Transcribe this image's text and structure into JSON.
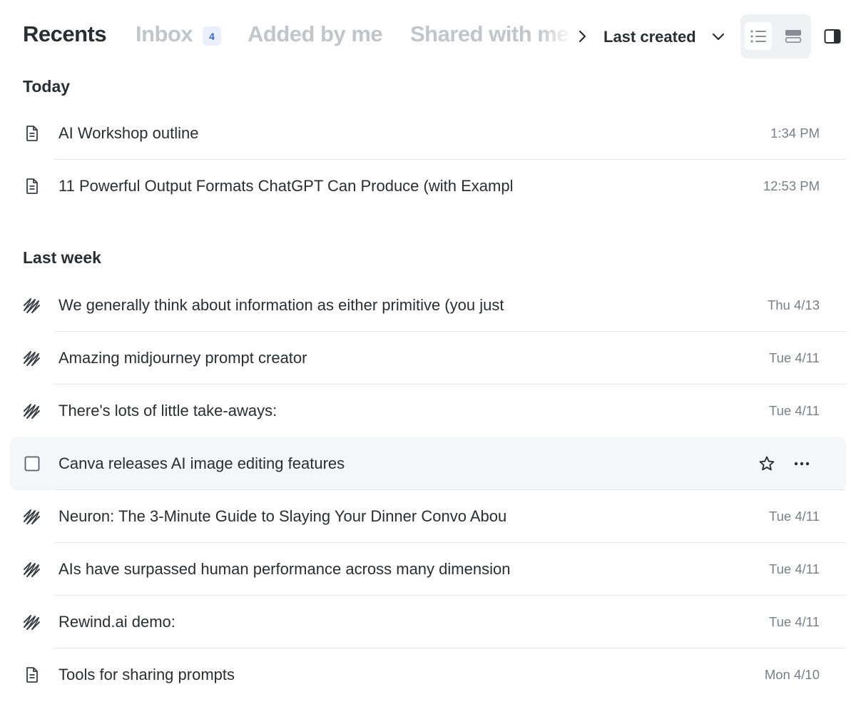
{
  "tabs": {
    "recents": "Recents",
    "inbox": "Inbox",
    "inbox_count": "4",
    "added_by_me": "Added by me",
    "shared_with_me": "Shared with me"
  },
  "sort": {
    "label": "Last created"
  },
  "sections": {
    "today": {
      "title": "Today",
      "items": [
        {
          "icon": "document-icon",
          "title": "AI Workshop outline",
          "date": "1:34 PM"
        },
        {
          "icon": "document-icon",
          "title": "11 Powerful Output Formats ChatGPT Can Produce (with Exampl",
          "date": "12:53 PM"
        }
      ]
    },
    "last_week": {
      "title": "Last week",
      "items": [
        {
          "icon": "scribble-icon",
          "title": "We generally think about information as either primitive (you just",
          "date": "Thu 4/13"
        },
        {
          "icon": "scribble-icon",
          "title": "Amazing midjourney prompt creator",
          "date": "Tue 4/11"
        },
        {
          "icon": "scribble-icon",
          "title": "There's lots of little take-aways:",
          "date": "Tue 4/11"
        },
        {
          "icon": "checkbox-icon",
          "title": "Canva releases AI image editing features",
          "date": "",
          "hovered": true
        },
        {
          "icon": "scribble-icon",
          "title": "Neuron: The 3-Minute Guide to Slaying Your Dinner Convo Abou",
          "date": "Tue 4/11"
        },
        {
          "icon": "scribble-icon",
          "title": "AIs have surpassed human performance across many dimension",
          "date": "Tue 4/11"
        },
        {
          "icon": "scribble-icon",
          "title": "Rewind.ai demo:",
          "date": "Tue 4/11"
        },
        {
          "icon": "document-icon",
          "title": "Tools for sharing prompts",
          "date": "Mon 4/10"
        }
      ]
    }
  },
  "colors": {
    "text_primary": "#2b2d33",
    "text_muted": "#c3c5cb",
    "badge_bg": "#eaf0fb",
    "badge_text": "#3a66c9",
    "hover_row": "#f5f6f8"
  }
}
